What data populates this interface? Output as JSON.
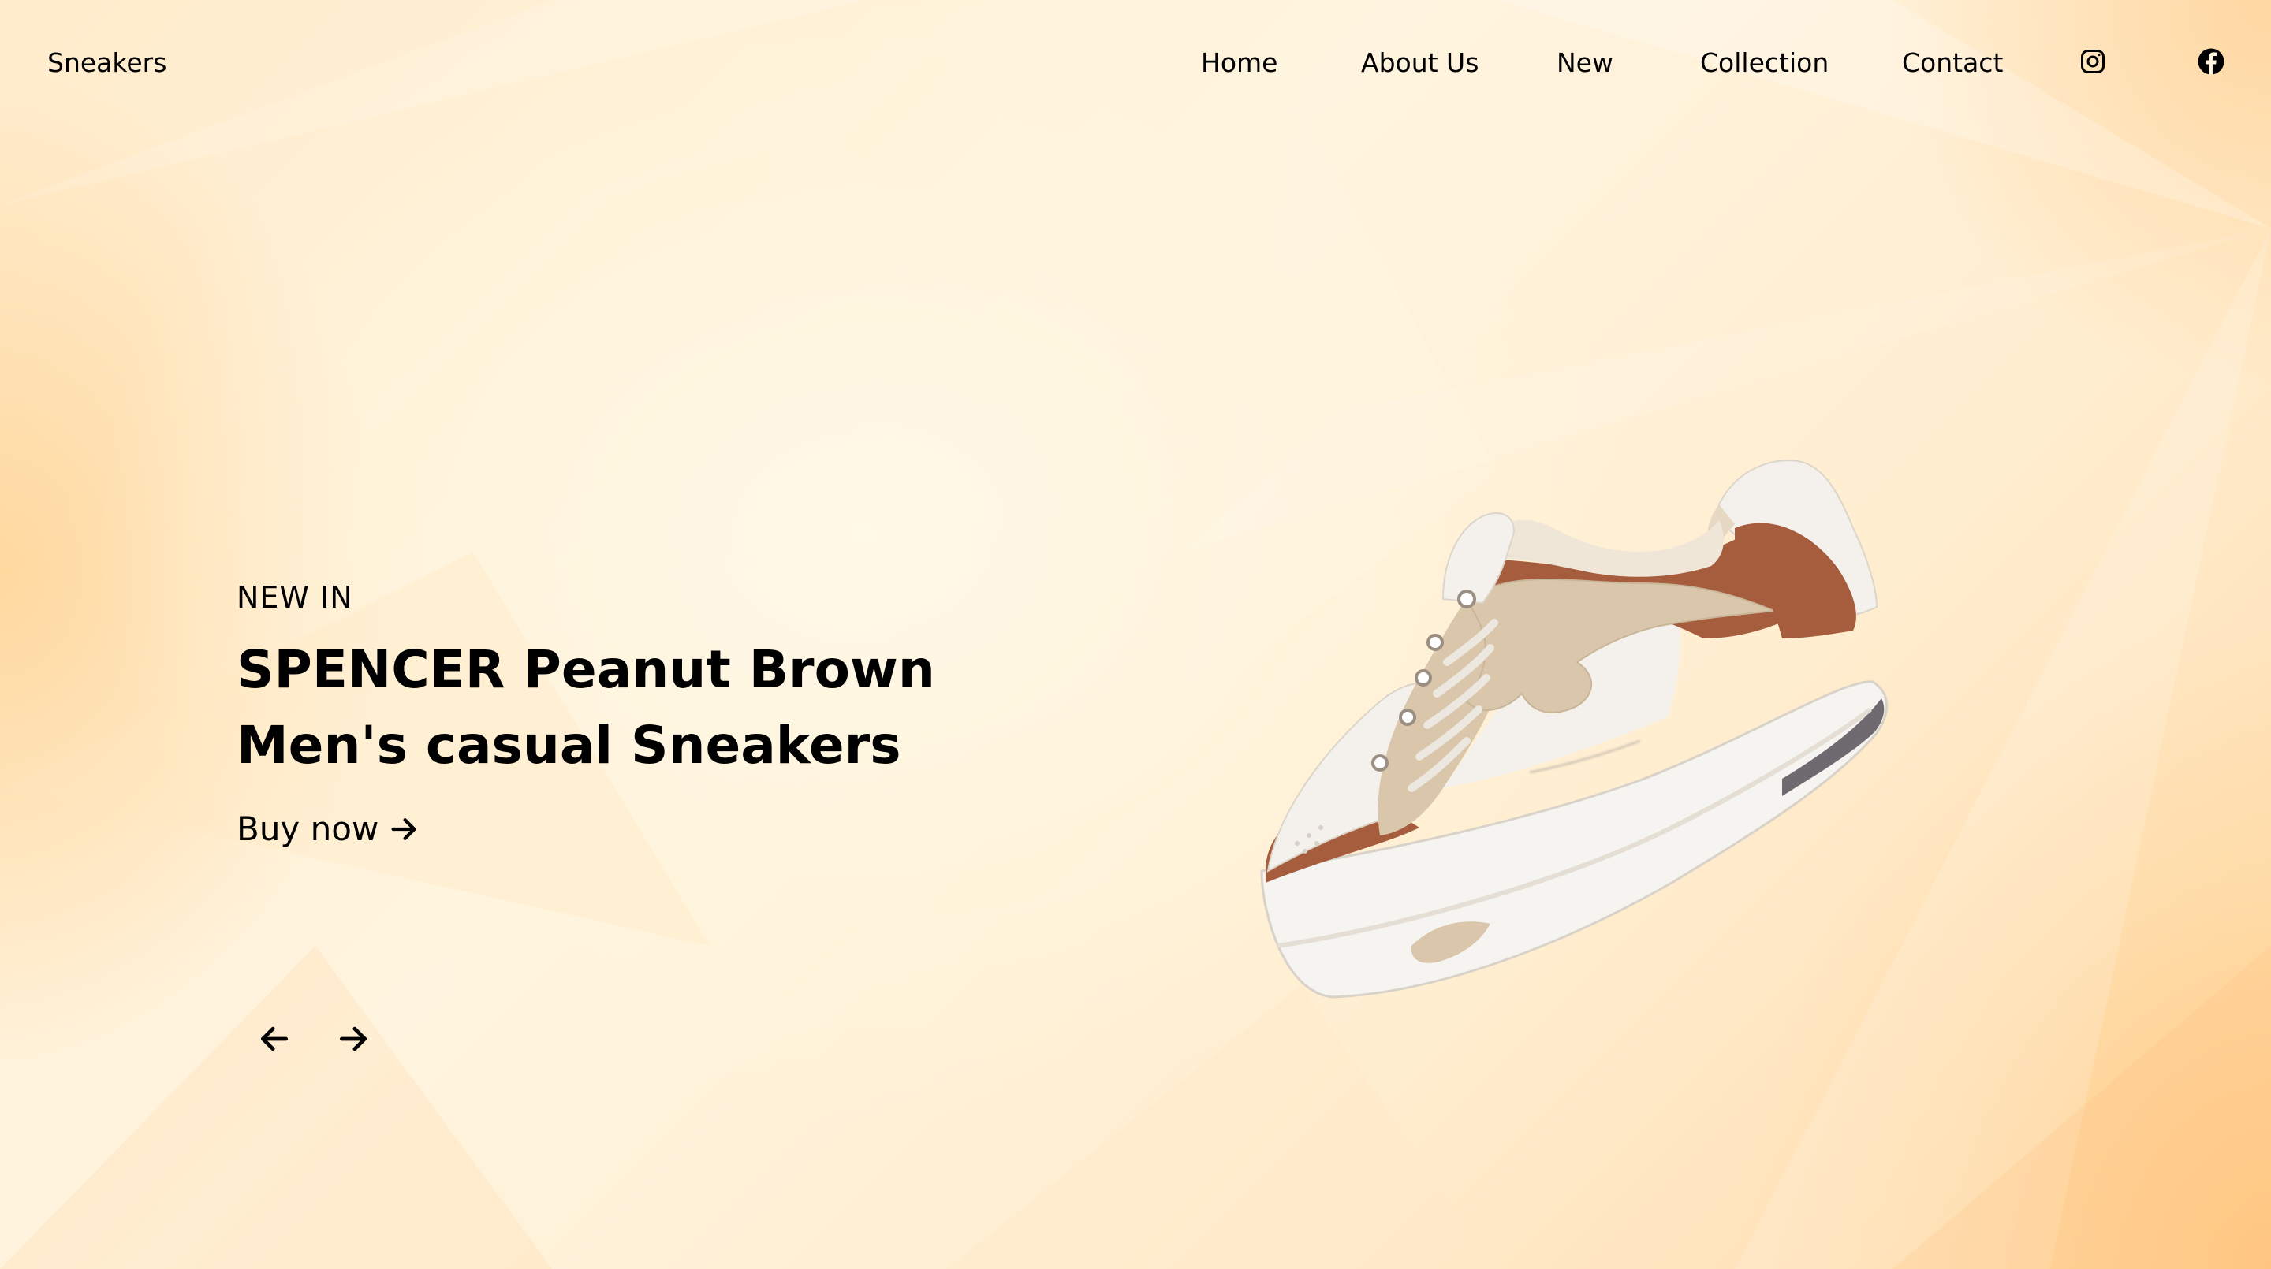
{
  "nav": {
    "brand": "Sneakers",
    "links": [
      "Home",
      "About Us",
      "New",
      "Collection",
      "Contact"
    ],
    "social": [
      "instagram-icon",
      "facebook-icon"
    ]
  },
  "hero": {
    "eyebrow": "NEW IN",
    "title_line1": "SPENCER Peanut Brown",
    "title_line2": "Men's casual Sneakers",
    "cta_label": "Buy now",
    "cta_icon": "arrow-right-icon"
  },
  "slider": {
    "prev_icon": "arrow-left-icon",
    "next_icon": "arrow-right-icon"
  },
  "product_image": {
    "subject": "brown and white sneaker",
    "colors": {
      "brown": "#a65d3e",
      "beige": "#d9c6ab",
      "white": "#f4f1ec"
    }
  },
  "theme": {
    "background": "#fff2da",
    "accent": "#ffc27a",
    "text": "#000000"
  }
}
